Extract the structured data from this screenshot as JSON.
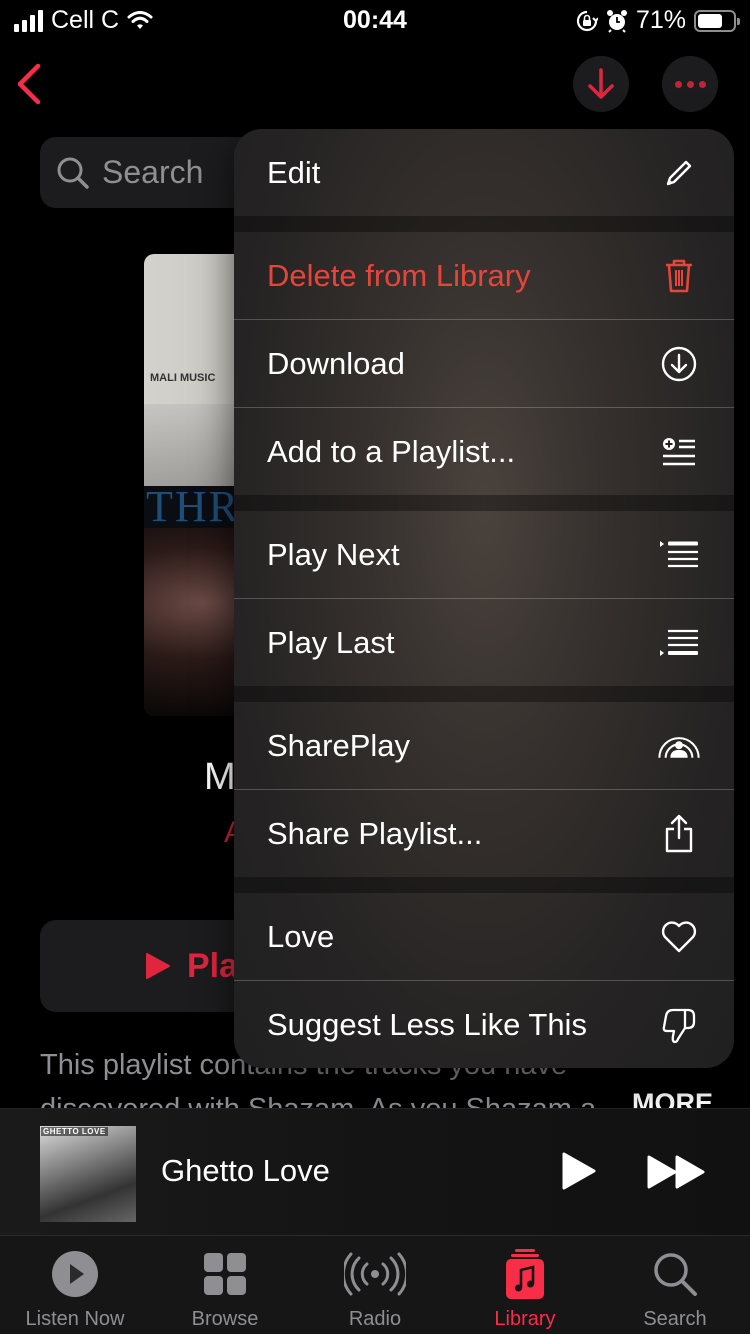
{
  "status_bar": {
    "carrier": "Cell C",
    "time": "00:44",
    "battery_percent": "71%",
    "battery_level": 0.71,
    "icons": [
      "signal-icon",
      "wifi-icon",
      "orientation-lock-icon",
      "alarm-icon",
      "battery-icon"
    ]
  },
  "nav": {
    "back_icon": "chevron-left-icon",
    "download_icon": "arrow-down-icon",
    "more_icon": "ellipsis-icon"
  },
  "search": {
    "placeholder": "Search"
  },
  "playlist": {
    "artwork_text_top": "MALI MUSIC",
    "artwork_text_band": "THR",
    "title_fragment": "M",
    "subtitle_fragment": "A",
    "play_label": "Pla",
    "description_line1": "This playlist contains the tracks you have",
    "description_line2": "discovered with Shazam. As you Shazam a",
    "more_label": "MORE"
  },
  "menu": {
    "items": [
      {
        "label": "Edit",
        "icon": "pencil-icon",
        "style": "normal"
      },
      {
        "label": "Delete from Library",
        "icon": "trash-icon",
        "style": "destructive"
      },
      {
        "label": "Download",
        "icon": "download-circle-icon",
        "style": "normal"
      },
      {
        "label": "Add to a Playlist...",
        "icon": "add-to-playlist-icon",
        "style": "normal"
      },
      {
        "label": "Play Next",
        "icon": "play-next-icon",
        "style": "normal"
      },
      {
        "label": "Play Last",
        "icon": "play-last-icon",
        "style": "normal"
      },
      {
        "label": "SharePlay",
        "icon": "shareplay-icon",
        "style": "normal"
      },
      {
        "label": "Share Playlist...",
        "icon": "share-icon",
        "style": "normal"
      },
      {
        "label": "Love",
        "icon": "heart-icon",
        "style": "normal"
      },
      {
        "label": "Suggest Less Like This",
        "icon": "thumbs-down-icon",
        "style": "normal"
      }
    ]
  },
  "mini_player": {
    "title": "Ghetto Love",
    "artwork_title": "GHETTO LOVE"
  },
  "tab_bar": {
    "tabs": [
      {
        "label": "Listen Now",
        "icon": "play-circle-icon",
        "active": false
      },
      {
        "label": "Browse",
        "icon": "grid-icon",
        "active": false
      },
      {
        "label": "Radio",
        "icon": "radio-waves-icon",
        "active": false
      },
      {
        "label": "Library",
        "icon": "library-icon",
        "active": true
      },
      {
        "label": "Search",
        "icon": "search-icon",
        "active": false
      }
    ]
  },
  "colors": {
    "accent": "#fa2d48",
    "destructive": "#e5453a",
    "secondary_text": "#8e8e93",
    "control_bg": "#1c1c1e"
  }
}
